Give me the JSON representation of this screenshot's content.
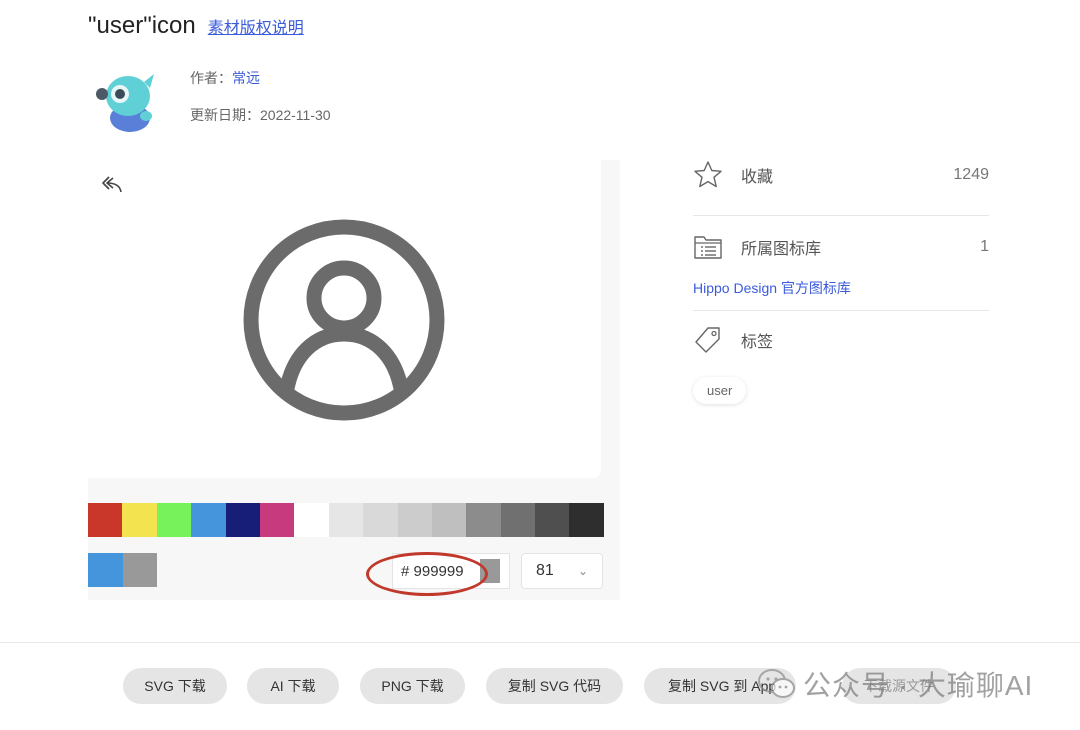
{
  "header": {
    "title": "\"user\"icon",
    "license_link": "素材版权说明"
  },
  "author": {
    "label": "作者：",
    "name": "常远",
    "date_label": "更新日期：",
    "date": "2022-11-30"
  },
  "editor": {
    "palette": [
      "#c8372a",
      "#f3e34f",
      "#78f25a",
      "#4495dc",
      "#171e78",
      "#c73a7e",
      "#ffffff",
      "#e6e6e6",
      "#d9d9d9",
      "#cccccc",
      "#bfbfbf",
      "#8c8c8c",
      "#707070",
      "#4f4f4f",
      "#2e2e2e"
    ],
    "selected_colors": [
      "#4495dc",
      "#999999"
    ],
    "hex_prefix": "#",
    "hex_value": "999999",
    "size_value": "81",
    "icon_color": "#6b6b6b"
  },
  "sidebar": {
    "favorites_label": "收藏",
    "favorites_count": "1249",
    "library_label": "所属图标库",
    "library_count": "1",
    "library_link": "Hippo Design 官方图标库",
    "tags_label": "标签",
    "tag": "user"
  },
  "actions": {
    "svg_download": "SVG 下载",
    "ai_download": "AI 下载",
    "png_download": "PNG 下载",
    "copy_svg_code": "复制 SVG 代码",
    "copy_svg_app": "复制 SVG 到 App",
    "source_file": "下载源文件"
  },
  "watermark": {
    "text": "公众号 · 大瑜聊AI"
  }
}
